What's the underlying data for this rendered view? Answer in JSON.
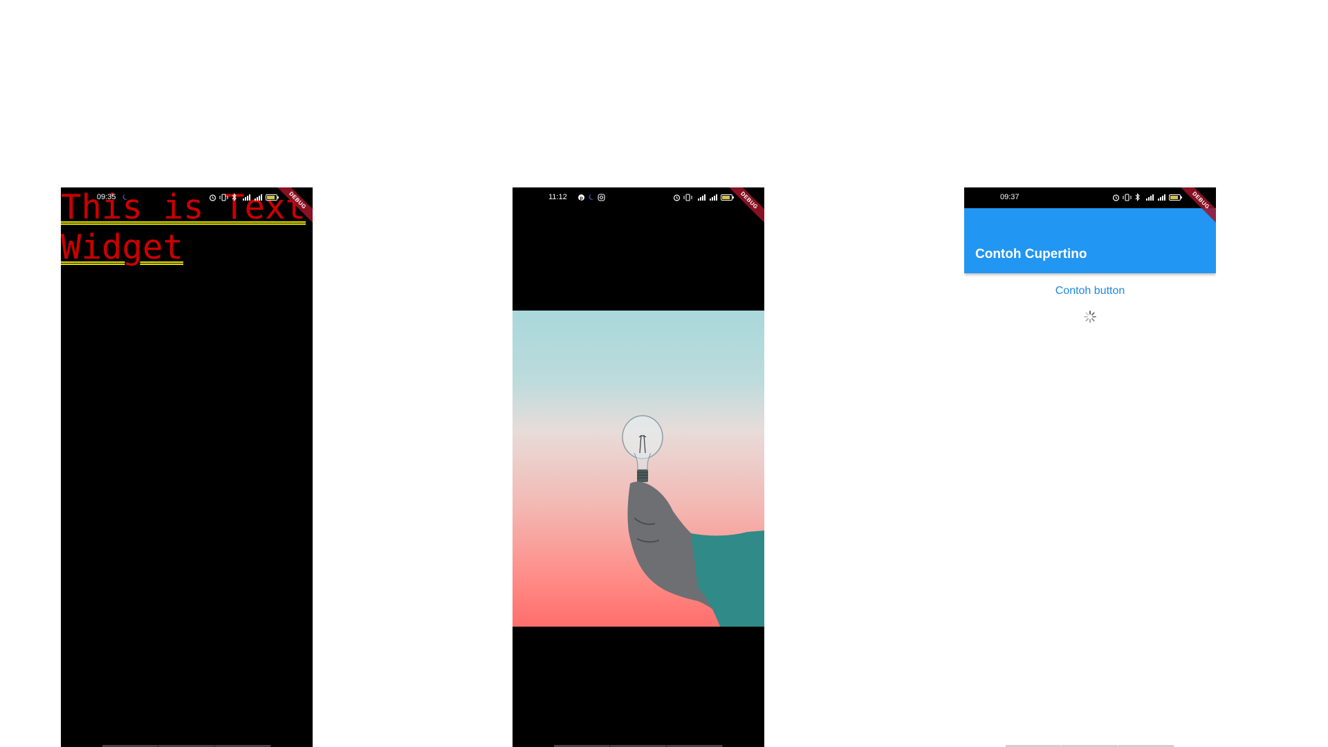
{
  "screens": [
    {
      "status_time": "09:35",
      "debug_label": "DEBUG",
      "text_widget": "This is Text Widget"
    },
    {
      "status_time": "11:12",
      "debug_label": "DEBUG",
      "image_subject": "hand holding light bulb against sky"
    },
    {
      "status_time": "09:37",
      "debug_label": "DEBUG",
      "app_bar_title": "Contoh Cupertino",
      "button_label": "Contoh button"
    }
  ],
  "icons": {
    "status": [
      "alarm-icon",
      "vibrate-icon",
      "bluetooth-icon",
      "signal-4g-icon",
      "signal-icon",
      "battery-icon"
    ],
    "screen2_notifications": [
      "pinterest-icon",
      "moon-icon",
      "instagram-icon"
    ],
    "spinner": "activity-indicator-icon"
  },
  "colors": {
    "text_widget": "#cc0000",
    "underline": "#e6e600",
    "app_bar": "#2196f3",
    "button_text": "#1e88e5",
    "debug_ribbon": "#a01428"
  }
}
